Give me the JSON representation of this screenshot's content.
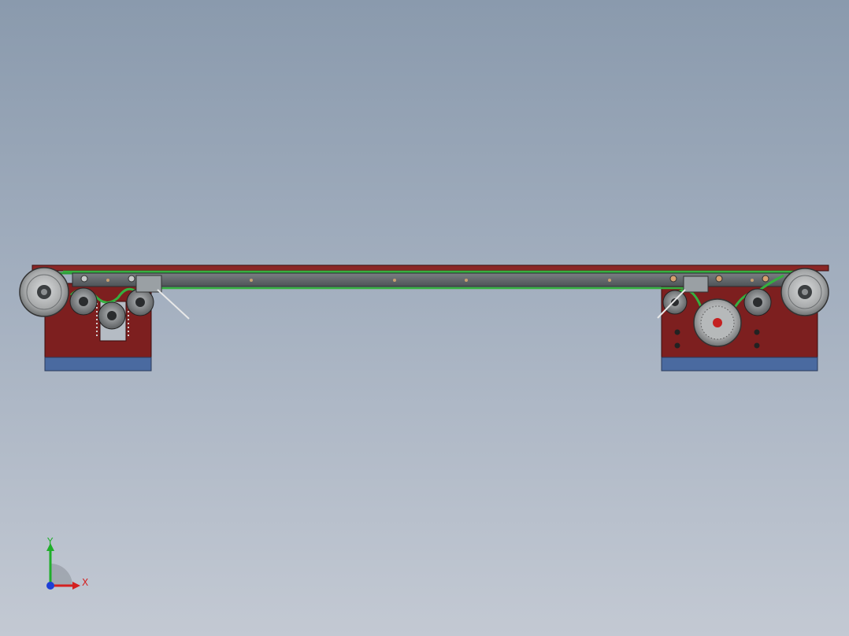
{
  "viewport": {
    "name": "cad-model-viewport",
    "background_top": "#8a9aad",
    "background_bottom": "#c3c9d3"
  },
  "model": {
    "name": "belt-conveyor-assembly",
    "frame_color": "#7d1f1f",
    "base_color": "#4a6aa0",
    "belt_color": "#2f9a3a",
    "rail_color": "#5f6468",
    "pulley_color": "#a7a9aa"
  },
  "triad": {
    "x_label": "X",
    "y_label": "Y",
    "x_color": "#d42020",
    "y_color": "#1fae2a",
    "z_color": "#1d3fd6"
  }
}
